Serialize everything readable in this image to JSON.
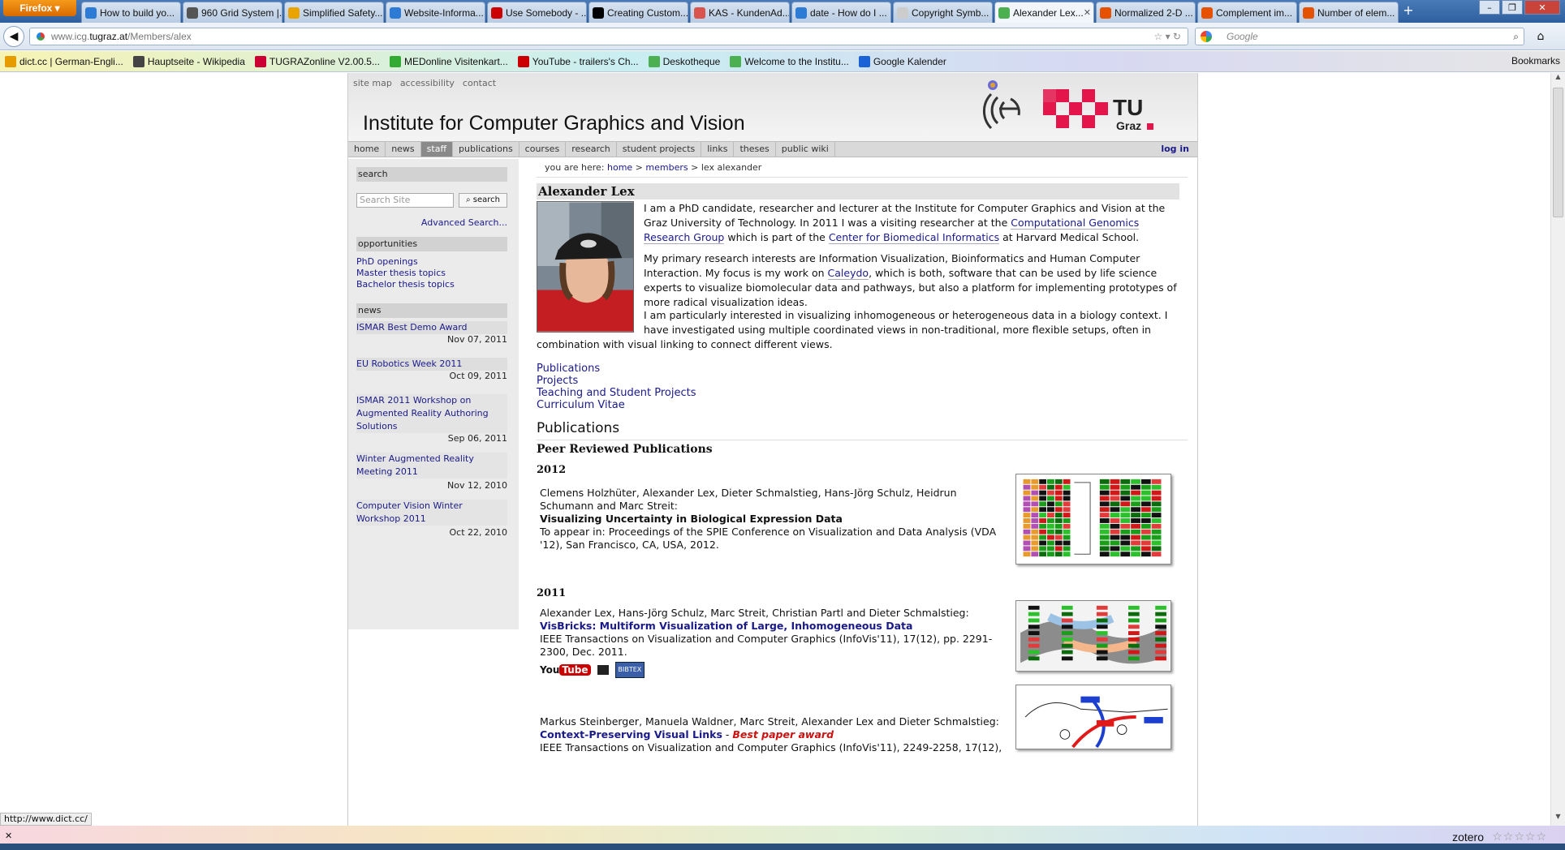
{
  "browser": {
    "menu_label": "Firefox",
    "tabs": [
      {
        "label": "How to build yo...",
        "color": "#2e7bd6"
      },
      {
        "label": "960 Grid System |...",
        "color": "#555555"
      },
      {
        "label": "Simplified Safety...",
        "color": "#e9a400"
      },
      {
        "label": "Website-Informa...",
        "color": "#2e7bd6"
      },
      {
        "label": "Use Somebody - ...",
        "color": "#cc0000"
      },
      {
        "label": "Creating Custom...",
        "color": "#000000"
      },
      {
        "label": "KAS - KundenAd...",
        "color": "#d9534f"
      },
      {
        "label": "date - How do I ...",
        "color": "#2e7bd6"
      },
      {
        "label": "Copyright Symb...",
        "color": "#cccccc"
      },
      {
        "label": "Alexander Lex...",
        "color": "#4caf50"
      },
      {
        "label": "Normalized 2-D ...",
        "color": "#e65100"
      },
      {
        "label": "Complement im...",
        "color": "#e65100"
      },
      {
        "label": "Number of elem...",
        "color": "#e65100"
      }
    ],
    "url_prefix": "www.icg.",
    "url_domain": "tugraz.at",
    "url_path": "/Members/alex",
    "search_placeholder": "Google",
    "bookmarks": [
      {
        "label": "dict.cc | German-Engli...",
        "color": "#e69b00"
      },
      {
        "label": "Hauptseite - Wikipedia",
        "color": "#444444"
      },
      {
        "label": "TUGRAZonline V2.00.5...",
        "color": "#cc0033"
      },
      {
        "label": "MEDonline Visitenkart...",
        "color": "#33aa33"
      },
      {
        "label": "YouTube - trailers's Ch...",
        "color": "#cc0000"
      },
      {
        "label": "Deskotheque",
        "color": "#4caf50"
      },
      {
        "label": "Welcome to the Institu...",
        "color": "#4caf50"
      },
      {
        "label": "Google Kalender",
        "color": "#1a62d6"
      }
    ],
    "bookmarks_menu": "Bookmarks",
    "status_url": "http://www.dict.cc/",
    "zotero": "zotero"
  },
  "site": {
    "toplinks": [
      "site map",
      "accessibility",
      "contact"
    ],
    "title": "Institute for Computer Graphics and Vision",
    "menu": [
      "home",
      "news",
      "staff",
      "publications",
      "courses",
      "research",
      "student projects",
      "links",
      "theses",
      "public wiki"
    ],
    "active_menu": "staff",
    "login": "log in"
  },
  "sidebar": {
    "search_heading": "search",
    "search_placeholder": "Search Site",
    "search_button": "search",
    "advanced": "Advanced Search...",
    "opportunities_heading": "opportunities",
    "opportunities": [
      "PhD openings",
      "Master thesis topics",
      "Bachelor thesis topics"
    ],
    "news_heading": "news",
    "news": [
      {
        "title": "ISMAR Best Demo Award",
        "date": "Nov 07, 2011"
      },
      {
        "title": "EU Robotics Week 2011",
        "date": "Oct 09, 2011"
      },
      {
        "title": "ISMAR 2011 Workshop on Augmented Reality Authoring Solutions",
        "date": "Sep 06, 2011"
      },
      {
        "title": "Winter Augmented Reality Meeting 2011",
        "date": "Nov 12, 2010"
      },
      {
        "title": "Computer Vision Winter Workshop 2011",
        "date": "Oct 22, 2010"
      }
    ]
  },
  "main": {
    "crumb_prefix": "you are here:",
    "crumb_home": "home",
    "crumb_members": "members",
    "crumb_current": "lex alexander",
    "name": "Alexander Lex",
    "bio1_a": "I am a PhD candidate, researcher and lecturer at the Institute for Computer Graphics and Vision at the Graz University of Technology. In 2011 I was a visiting researcher at the ",
    "bio1_link1": "Computational Genomics Research Group",
    "bio1_b": " which is part of the ",
    "bio1_link2": "Center for Biomedical Informatics",
    "bio1_c": " at Harvard Medical School.",
    "bio2_a": "My primary research interests are Information Visualization, Bioinformatics and Human Computer Interaction. My focus is my work on ",
    "bio2_link": "Caleydo",
    "bio2_b": ", which is both, software that can be used by life science experts to visualize biomolecular data and pathways, but also a platform for implementing prototypes of more radical visualization ideas.",
    "bio3_a": "I am particularly interested in visualizing inhomogeneous or heterogeneous data in a biology context. I have investigated using multiple coordinated views in non-traditional, more flexible setups, often in",
    "bio3_b": "combination with visual linking to connect different views.",
    "quick_links": [
      "Publications",
      "Projects",
      "Teaching and Student Projects",
      "Curriculum Vitae"
    ],
    "publications_heading": "Publications",
    "peer_heading": "Peer Reviewed Publications",
    "year1": "2012",
    "pub1_authors": "Clemens Holzhüter, Alexander Lex, Dieter Schmalstieg, Hans-Jörg Schulz, Heidrun Schumann and Marc Streit:",
    "pub1_title": "Visualizing Uncertainty in Biological Expression Data",
    "pub1_venue": "To appear in: Proceedings of the SPIE Conference on Visualization and Data Analysis (VDA '12), San Francisco, CA, USA, 2012.",
    "year2": "2011",
    "pub2_authors": "Alexander Lex, Hans-Jörg Schulz, Marc Streit, Christian Partl and Dieter Schmalstieg:",
    "pub2_title": "VisBricks: Multiform Visualization of Large, Inhomogeneous Data",
    "pub2_venue": "IEEE Transactions on Visualization and Computer Graphics (InfoVis'11), 17(12), pp. 2291-2300, Dec. 2011.",
    "pub2_youtube_a": "You",
    "pub2_youtube_b": "Tube",
    "pub2_bibtex": "BIBTEX",
    "pub3_authors": "Markus Steinberger, Manuela Waldner, Marc Streit, Alexander Lex and Dieter Schmalstieg:",
    "pub3_title": "Context-Preserving Visual Links",
    "pub3_sep": " - ",
    "pub3_award": "Best paper award",
    "pub3_venue": "IEEE Transactions on Visualization and Computer Graphics (InfoVis'11), 2249-2258, 17(12),"
  }
}
